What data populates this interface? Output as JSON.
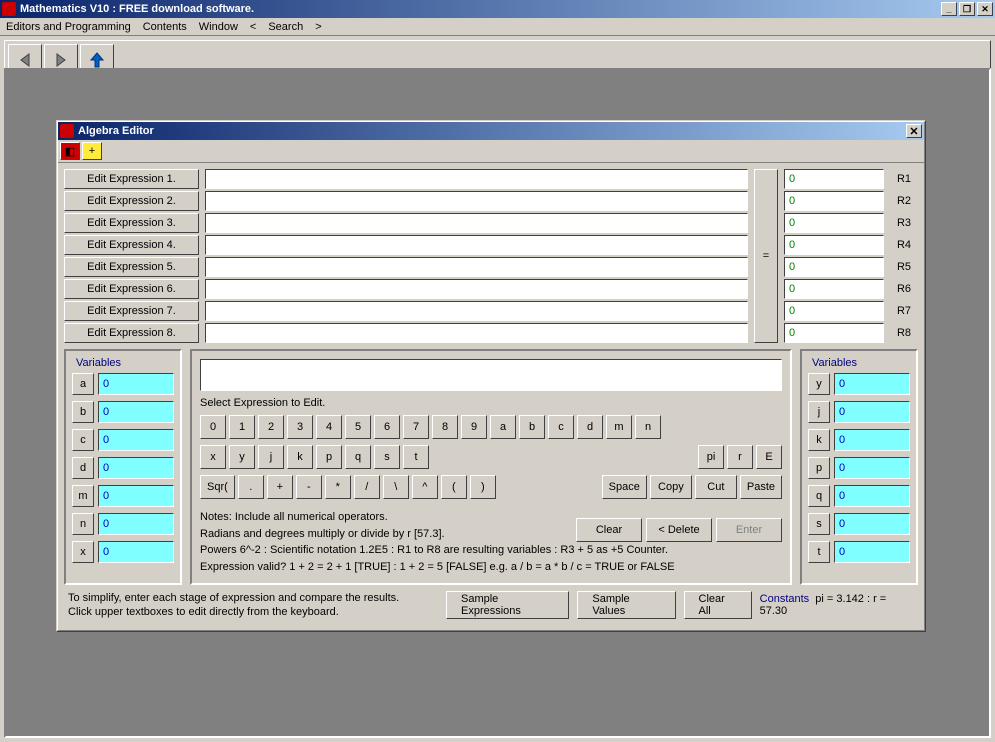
{
  "main_title": "Mathematics V10 : FREE download software.",
  "menu": [
    "Editors and Programming",
    "Contents",
    "Window",
    "<",
    "Search",
    ">"
  ],
  "sub_title": "Algebra Editor",
  "expressions": [
    {
      "label": "Edit Expression 1.",
      "value": "",
      "result": "0",
      "r": "R1"
    },
    {
      "label": "Edit Expression 2.",
      "value": "",
      "result": "0",
      "r": "R2"
    },
    {
      "label": "Edit Expression 3.",
      "value": "",
      "result": "0",
      "r": "R3"
    },
    {
      "label": "Edit Expression 4.",
      "value": "",
      "result": "0",
      "r": "R4"
    },
    {
      "label": "Edit Expression 5.",
      "value": "",
      "result": "0",
      "r": "R5"
    },
    {
      "label": "Edit Expression 6.",
      "value": "",
      "result": "0",
      "r": "R6"
    },
    {
      "label": "Edit Expression 7.",
      "value": "",
      "result": "0",
      "r": "R7"
    },
    {
      "label": "Edit Expression 8.",
      "value": "",
      "result": "0",
      "r": "R8"
    }
  ],
  "eq_label": "=",
  "vars_left": [
    {
      "name": "a",
      "value": "0"
    },
    {
      "name": "b",
      "value": "0"
    },
    {
      "name": "c",
      "value": "0"
    },
    {
      "name": "d",
      "value": "0"
    },
    {
      "name": "m",
      "value": "0"
    },
    {
      "name": "n",
      "value": "0"
    },
    {
      "name": "x",
      "value": "0"
    }
  ],
  "vars_right": [
    {
      "name": "y",
      "value": "0"
    },
    {
      "name": "j",
      "value": "0"
    },
    {
      "name": "k",
      "value": "0"
    },
    {
      "name": "p",
      "value": "0"
    },
    {
      "name": "q",
      "value": "0"
    },
    {
      "name": "s",
      "value": "0"
    },
    {
      "name": "t",
      "value": "0"
    }
  ],
  "var_title": "Variables",
  "select_label": "Select Expression to Edit.",
  "keys_row1": [
    "0",
    "1",
    "2",
    "3",
    "4",
    "5",
    "6",
    "7",
    "8",
    "9",
    "a",
    "b",
    "c",
    "d",
    "m",
    "n"
  ],
  "keys_row2_left": [
    "x",
    "y",
    "j",
    "k",
    "p",
    "q",
    "s",
    "t"
  ],
  "keys_row2_right": [
    "pi",
    "r",
    "E"
  ],
  "keys_row3_left": [
    "Sqr(",
    ".",
    "+",
    "-",
    "*",
    "/",
    "\\",
    "^",
    "(",
    ")"
  ],
  "keys_row3_right": [
    "Space",
    "Copy",
    "Cut",
    "Paste"
  ],
  "action_buttons": {
    "clear": "Clear",
    "delete": "< Delete",
    "enter": "Enter"
  },
  "notes": [
    "Notes:  Include all numerical operators.",
    "Radians and degrees multiply or divide by r [57.3].",
    "Powers 6^-2 : Scientific notation 1.2E5 : R1 to R8 are resulting variables : R3 + 5 as +5 Counter.",
    "Expression valid?    1 + 2 = 2 + 1 [TRUE] : 1 + 2 = 5 [FALSE]    e.g. a / b = a * b / c  = TRUE or FALSE"
  ],
  "bottom_text": [
    "To simplify, enter each stage of expression and compare the results.",
    "Click upper textboxes to edit directly from the keyboard."
  ],
  "bottom_buttons": {
    "sample_expr": "Sample Expressions",
    "sample_vals": "Sample Values",
    "clear_all": "Clear All"
  },
  "constants": {
    "label": "Constants",
    "value": "pi = 3.142 : r = 57.30"
  }
}
